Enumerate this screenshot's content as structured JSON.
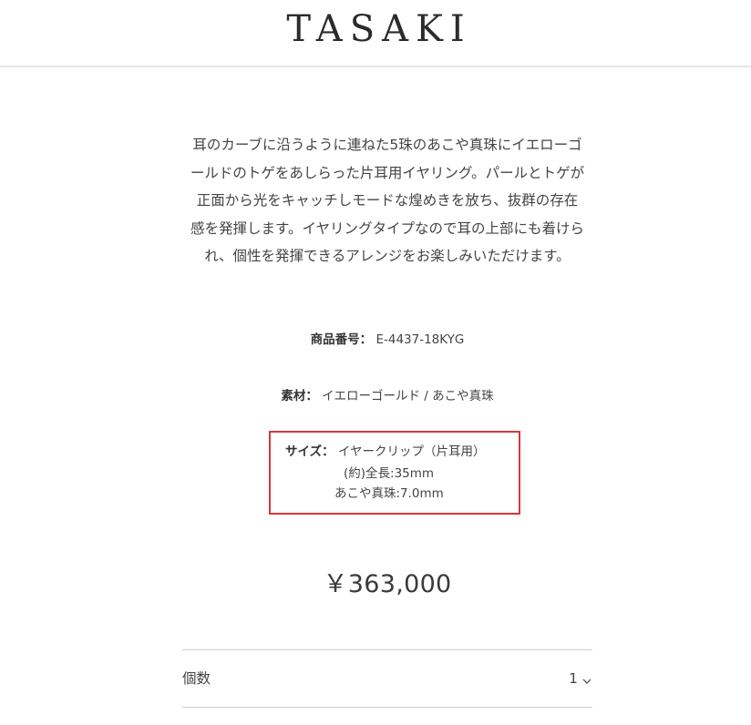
{
  "header": {
    "logo_text": "TASAKI"
  },
  "product": {
    "description_lines": [
      "耳のカーブに沿うように連ねた5珠のあこや真珠にイエローゴ",
      "ールドのトゲをあしらった片耳用イヤリング。パールとトゲが",
      "正面から光をキャッチしモードな煌めきを放ち、抜群の存在",
      "感を発揮します。イヤリングタイプなので耳の上部にも着けら",
      "れ、個性を発揮できるアレンジをお楽しみいただけます。"
    ],
    "specs": {
      "code_label": "商品番号：",
      "code_value": "E-4437-18KYG",
      "material_label": "素材：",
      "material_value": "イエローゴールド / あこや真珠",
      "size_label": "サイズ：",
      "size_line1": "イヤークリップ（片耳用）",
      "size_line2": "(約)全長:35mm",
      "size_line3": "あこや真珠:7.0mm"
    },
    "price": "￥363,000",
    "quantity": {
      "label": "個数",
      "value": "1"
    }
  },
  "colors": {
    "highlight_border": "#d9373a",
    "divider": "#cfcfcf",
    "header_border": "#e3e9e9"
  }
}
